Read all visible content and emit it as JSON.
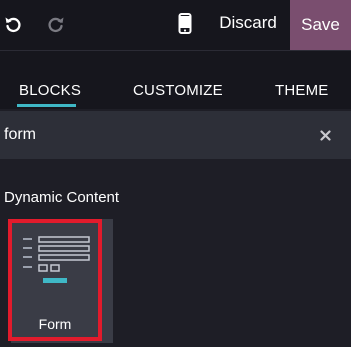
{
  "toolbar": {
    "undo_icon": "undo-icon",
    "redo_icon": "redo-icon",
    "mobile_icon": "mobile-preview-icon",
    "discard_label": "Discard",
    "save_label": "Save"
  },
  "tabs": [
    {
      "label": "BLOCKS",
      "active": true
    },
    {
      "label": "CUSTOMIZE",
      "active": false
    },
    {
      "label": "THEME",
      "active": false
    }
  ],
  "search": {
    "value": "form",
    "clear_icon": "close-icon"
  },
  "section": {
    "title": "Dynamic Content"
  },
  "snippets": [
    {
      "label": "Form",
      "icon": "form-snippet-icon",
      "highlighted": true
    }
  ],
  "colors": {
    "background": "#1e1e26",
    "topbar": "#16161d",
    "save": "#7a4e6f",
    "accent": "#3fb8c6",
    "highlight": "#e21b2c",
    "search_bg": "#2d2f38",
    "card_bg": "#3a3c46"
  }
}
